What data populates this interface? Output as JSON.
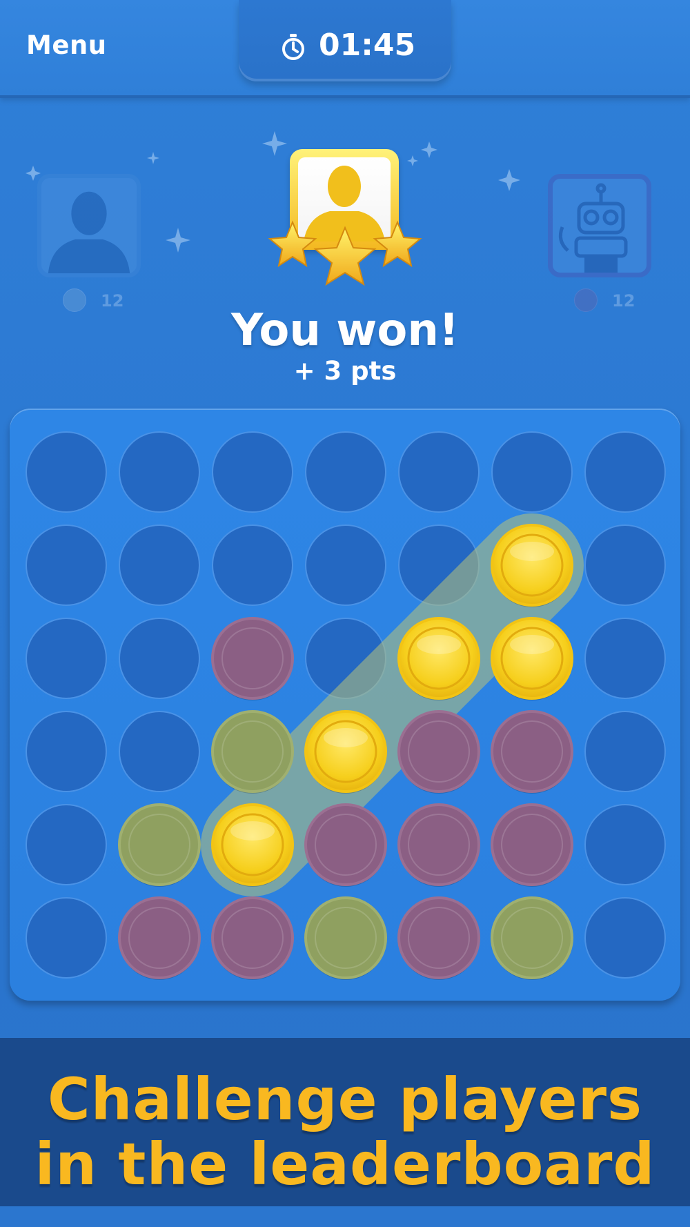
{
  "header": {
    "menu_label": "Menu",
    "timer": "01:45",
    "timer_icon": "stopwatch-icon"
  },
  "players": {
    "left": {
      "avatar": "person-silhouette-icon",
      "score": "12"
    },
    "right": {
      "avatar": "robot-icon",
      "score": "12"
    },
    "winner": {
      "avatar": "person-silhouette-icon",
      "stars": 3
    }
  },
  "result": {
    "title": "You won!",
    "points": "+ 3 pts"
  },
  "board": {
    "columns": 7,
    "rows": 6,
    "cells": [
      [
        "empty",
        "empty",
        "empty",
        "empty",
        "empty",
        "empty",
        "empty"
      ],
      [
        "empty",
        "empty",
        "empty",
        "empty",
        "empty",
        "yellow",
        "empty"
      ],
      [
        "empty",
        "empty",
        "red",
        "empty",
        "yellow",
        "yellow",
        "empty"
      ],
      [
        "empty",
        "empty",
        "yellow-dim",
        "yellow",
        "red",
        "red",
        "empty"
      ],
      [
        "empty",
        "yellow-dim",
        "yellow",
        "red",
        "red",
        "red",
        "empty"
      ],
      [
        "empty",
        "red",
        "red",
        "yellow-dim",
        "red",
        "yellow-dim",
        "empty"
      ]
    ],
    "winning_line": [
      [
        4,
        2
      ],
      [
        3,
        3
      ],
      [
        2,
        4
      ],
      [
        1,
        5
      ]
    ],
    "colors": {
      "board": "#2b80df",
      "hole": "#2468c2",
      "yellow": "#f7d21e",
      "red": "#8b5f84",
      "yellow_dim": "#8fa060",
      "highlight": "#b6c27a"
    }
  },
  "promo": {
    "line1": "Challenge players",
    "line2": "in the leaderboard",
    "color": "#f9b820"
  }
}
